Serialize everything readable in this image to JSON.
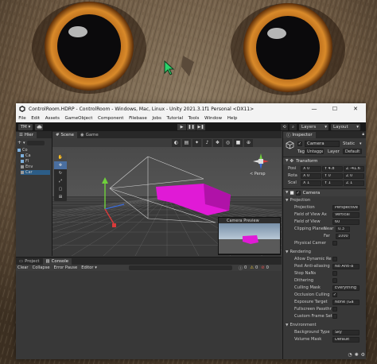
{
  "window": {
    "title": "ControlRoom.HDRP - ControlRoom - Windows, Mac, Linux - Unity 2021.3.1f1 Personal <DX11>",
    "minimize": "—",
    "maximize": "☐",
    "close": "✕"
  },
  "menu": [
    "File",
    "Edit",
    "Assets",
    "GameObject",
    "Component",
    "Filebase",
    "Jobs",
    "Tutorial",
    "Tools",
    "Window",
    "Help"
  ],
  "toolbar": {
    "account": "TM ▾",
    "play": "▶",
    "pause": "❚❚",
    "step": "▶❚",
    "layers": "Layers",
    "layout": "Layout"
  },
  "hierarchy": {
    "tab": "Hier",
    "items": [
      "Co",
      "Ca",
      "Fl",
      "Env",
      "Car"
    ]
  },
  "scene": {
    "tabs": [
      "Scene",
      "Game"
    ],
    "gizmo_label": "< Persp",
    "preview_title": "Camera Preview"
  },
  "bottom": {
    "tabs": [
      "Project",
      "Console"
    ],
    "buttons": [
      "Clear",
      "Collapse",
      "Error Pause",
      "Editor ▾"
    ],
    "counts": [
      "0",
      "0",
      "0"
    ]
  },
  "inspector": {
    "tab": "Inspector",
    "object_name": "Camera",
    "static_label": "Static",
    "tag_label": "Tag",
    "tag_value": "Untagged",
    "layer_label": "Layer",
    "layer_value": "Default",
    "transform": {
      "title": "Transform",
      "pos_label": "Posi",
      "pos": [
        "X 0",
        "Y 4.8",
        "Z -41.6"
      ],
      "rot_label": "Rota",
      "rot": [
        "X 0",
        "Y 0",
        "Z 0"
      ],
      "scale_label": "Scal",
      "scale": [
        "X 1",
        "Y 1",
        "Z 1"
      ]
    },
    "camera": {
      "title": "Camera",
      "projection_header": "Projection",
      "projection_label": "Projection",
      "projection_value": "Perspective",
      "fov_axis_label": "Field of View Ax",
      "fov_axis_value": "Vertical",
      "fov_label": "Field of View",
      "fov_value": "60",
      "clipping_label": "Clipping Planes",
      "near_label": "Near",
      "near_value": "0.3",
      "far_label": "Far",
      "far_value": "1000",
      "physical_label": "Physical Camer",
      "rendering_header": "Rendering",
      "allow_dynamic_label": "Allow Dynamic Re",
      "post_aa_label": "Post Anti-aliasing",
      "post_aa_value": "No Anti-a",
      "stop_nans_label": "Stop NaNs",
      "dithering_label": "Dithering",
      "culling_mask_label": "Culling Mask",
      "culling_mask_value": "Everything",
      "occlusion_label": "Occlusion Culling",
      "exposure_label": "Exposure Target",
      "exposure_value": "None (Ga",
      "fullscreen_label": "Fullscreen Passthr",
      "custom_frame_label": "Custom Frame Set",
      "environment_header": "Environment",
      "bg_type_label": "Background Type",
      "bg_type_value": "Sky",
      "volume_mask_label": "Volume Mask",
      "volume_mask_value": "Default"
    }
  }
}
